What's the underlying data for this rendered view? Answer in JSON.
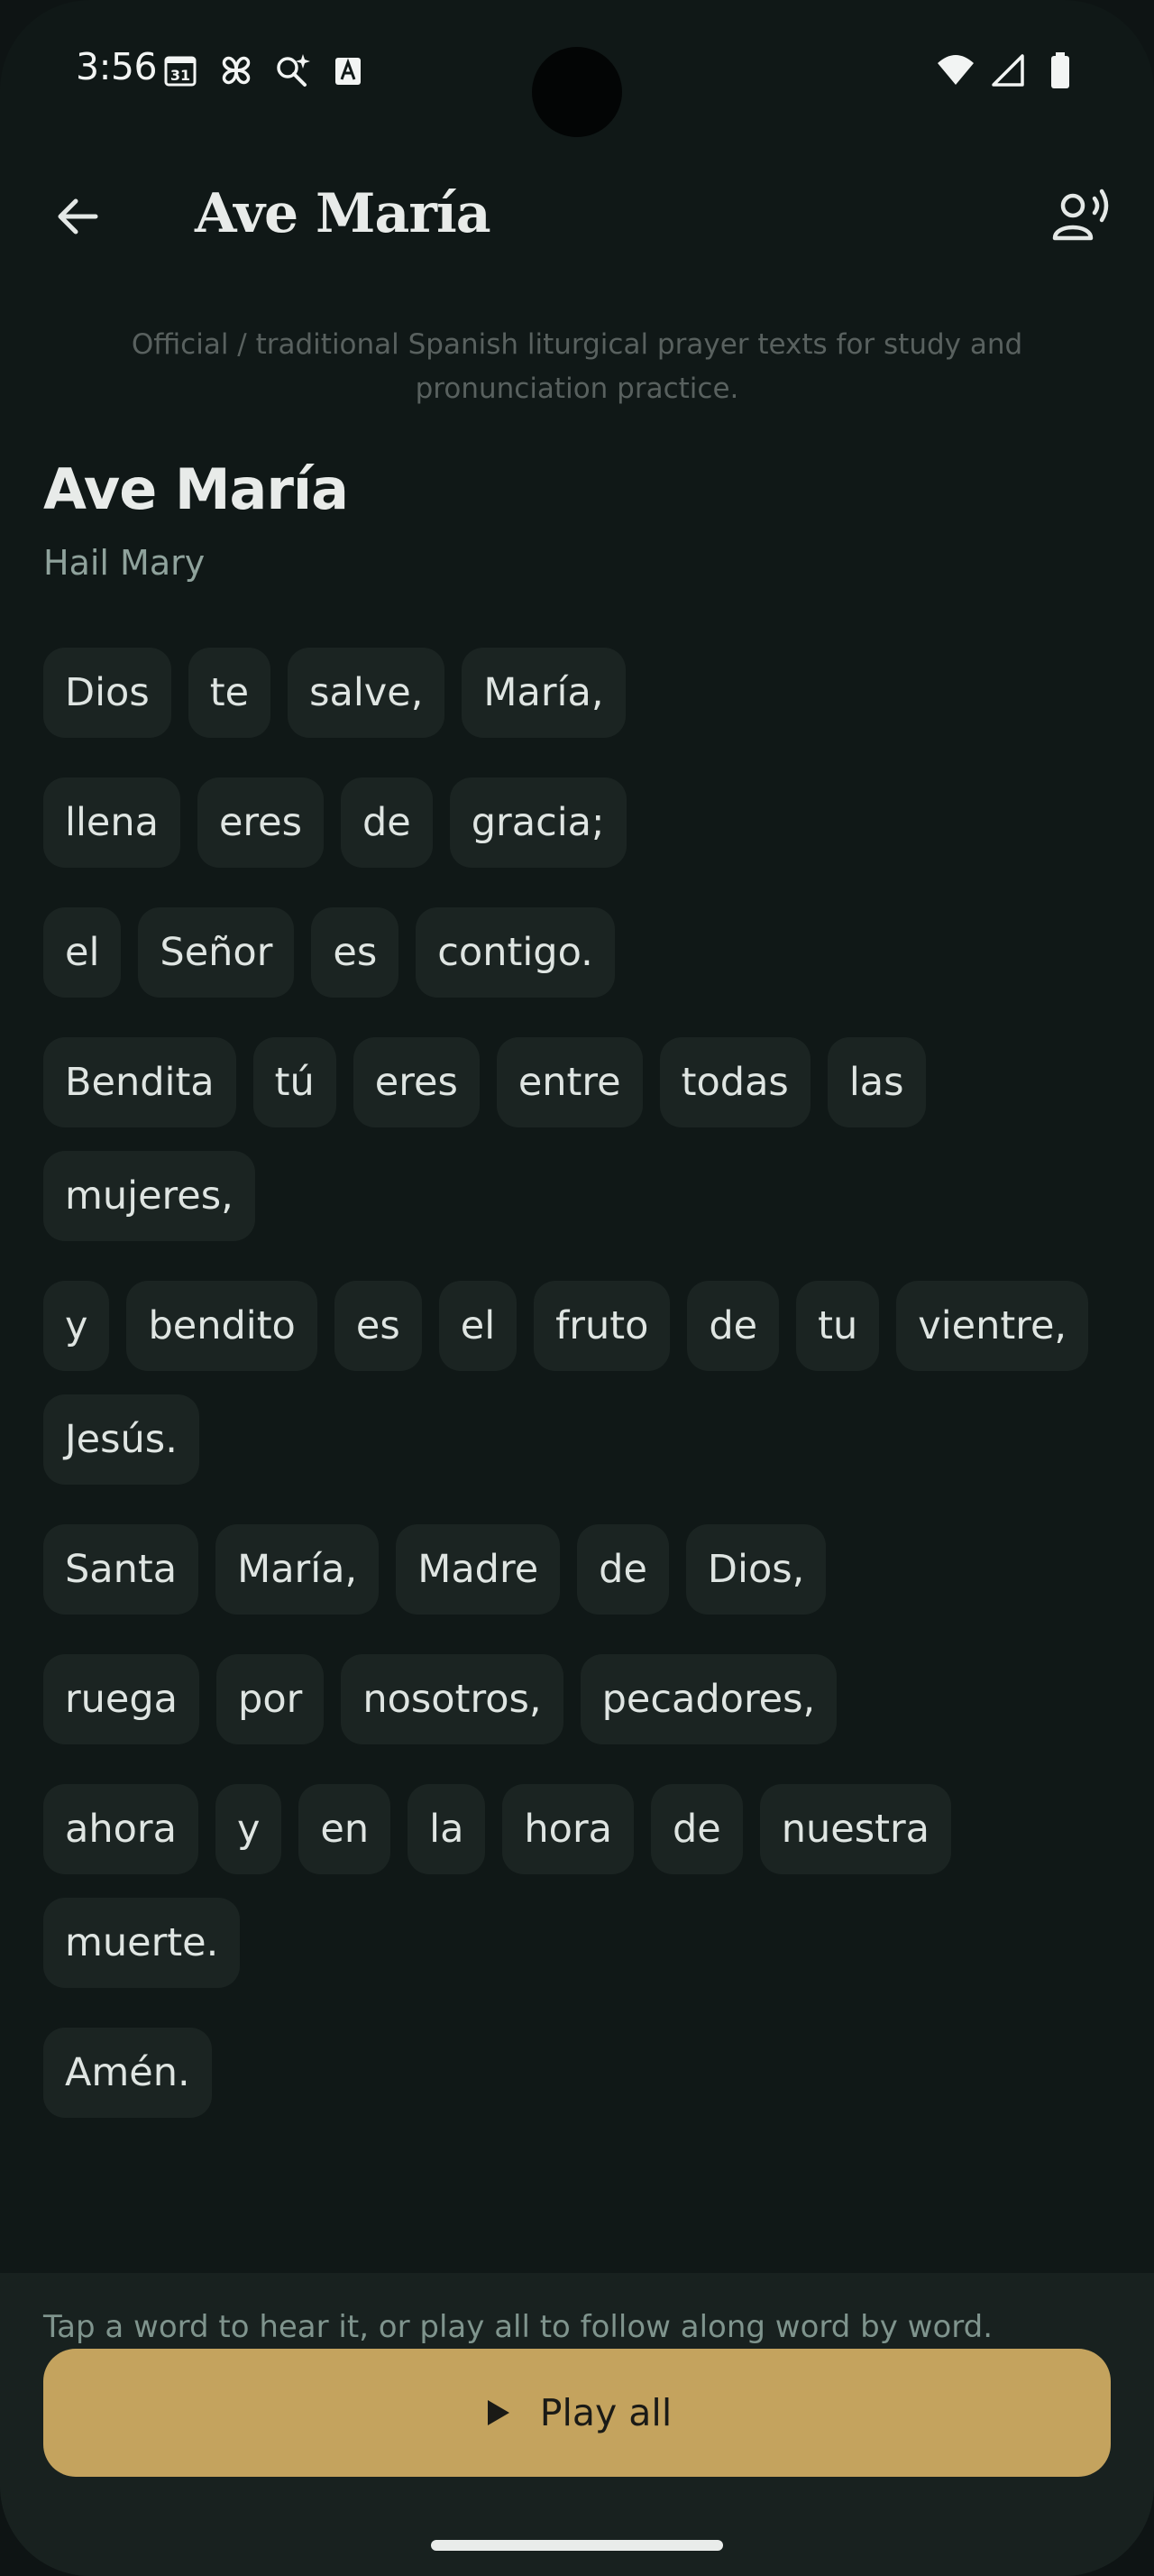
{
  "status_bar": {
    "time": "3:56",
    "calendar_day": "31",
    "icons_left": [
      "calendar-icon",
      "pinwheel-icon",
      "search-sparkle-icon",
      "font-icon"
    ],
    "icons_right": [
      "wifi-icon",
      "cell-signal-icon",
      "battery-icon"
    ]
  },
  "app_bar": {
    "title": "Ave María",
    "back_icon": "arrow-left-icon",
    "voice_icon": "voice-speaker-icon"
  },
  "disclaimer": "Official / traditional Spanish liturgical prayer texts for study and pronunciation practice.",
  "prayer": {
    "title": "Ave María",
    "subtitle": "Hail Mary",
    "lines": [
      [
        "Dios",
        "te",
        "salve,",
        "María,"
      ],
      [
        "llena",
        "eres",
        "de",
        "gracia;"
      ],
      [
        "el",
        "Señor",
        "es",
        "contigo."
      ],
      [
        "Bendita",
        "tú",
        "eres",
        "entre",
        "todas",
        "las",
        "mujeres,"
      ],
      [
        "y",
        "bendito",
        "es",
        "el",
        "fruto",
        "de",
        "tu",
        "vientre,",
        "Jesús."
      ],
      [
        "Santa",
        "María,",
        "Madre",
        "de",
        "Dios,"
      ],
      [
        "ruega",
        "por",
        "nosotros,",
        "pecadores,"
      ],
      [
        "ahora",
        "y",
        "en",
        "la",
        "hora",
        "de",
        "nuestra",
        "muerte."
      ],
      [
        "Amén."
      ]
    ]
  },
  "bottom": {
    "hint": "Tap a word to hear it, or play all to follow along word by word.",
    "play_label": "Play all",
    "play_icon": "play-icon"
  },
  "colors": {
    "background": "#101817",
    "chip": "#1b2422",
    "accent": "#c4a35e",
    "subtitle": "#8fa29c"
  }
}
